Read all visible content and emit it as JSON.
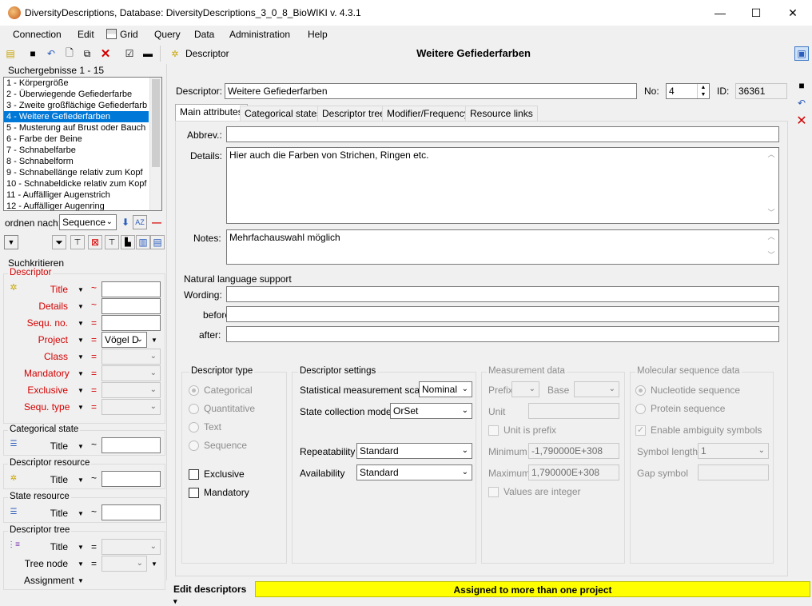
{
  "window": {
    "title": "DiversityDescriptions,  Database: DiversityDescriptions_3_0_8_BioWIKI    v. 4.3.1",
    "min": "—",
    "max": "☐",
    "close": "✕"
  },
  "menu": [
    "Connection",
    "Edit",
    "Grid",
    "Query",
    "Data",
    "Administration",
    "Help"
  ],
  "toolbar": {
    "descriptor_label": "Descriptor",
    "header_title": "Weitere Gefiederfarben"
  },
  "left": {
    "results_label": "Suchergebnisse   1 - 15",
    "results": [
      "1 - Körpergröße",
      "2 - Überwiegende Gefiederfarbe",
      "3 - Zweite großflächige Gefiederfarb",
      "4 - Weitere Gefiederfarben",
      "5 - Musterung auf Brust oder Bauch",
      "6 - Farbe der Beine",
      "7 - Schnabelfarbe",
      "8 - Schnabelform",
      "9 - Schnabellänge relativ zum Kopf",
      "10 - Schnabeldicke relativ zum Kopf",
      "11 - Auffälliger Augenstrich",
      "12 - Auffälliger Augenring"
    ],
    "sort_label": "ordnen nach:",
    "sort_value": "Sequence",
    "criteria_title": "Suchkritieren",
    "descriptor_group": "Descriptor",
    "descriptor_rows": [
      {
        "label": "Title",
        "op": "~",
        "value": ""
      },
      {
        "label": "Details",
        "op": "~",
        "value": ""
      },
      {
        "label": "Sequ. no.",
        "op": "=",
        "value": ""
      },
      {
        "label": "Project",
        "op": "=",
        "value": "Vögel D"
      },
      {
        "label": "Class",
        "op": "=",
        "value": ""
      },
      {
        "label": "Mandatory",
        "op": "=",
        "value": ""
      },
      {
        "label": "Exclusive",
        "op": "=",
        "value": ""
      },
      {
        "label": "Sequ. type",
        "op": "=",
        "value": ""
      }
    ],
    "cat_state_group": "Categorical state",
    "cat_state_title": "Title",
    "cat_state_op": "~",
    "desc_res_group": "Descriptor resource",
    "desc_res_title": "Title",
    "desc_res_op": "~",
    "state_res_group": "State resource",
    "state_res_title": "Title",
    "state_res_op": "~",
    "tree_group": "Descriptor tree",
    "tree_title": "Title",
    "tree_title_op": "=",
    "tree_node": "Tree node",
    "tree_node_op": "=",
    "assignment": "Assignment"
  },
  "form": {
    "descriptor_label": "Descriptor:",
    "descriptor_value": "Weitere Gefiederfarben",
    "no_label": "No:",
    "no_value": "4",
    "id_label": "ID:",
    "id_value": "36361",
    "tabs": [
      "Main attributes",
      "Categorical states",
      "Descriptor tree",
      "Modifier/Frequency",
      "Resource links"
    ],
    "abbrev_label": "Abbrev.:",
    "abbrev_value": "",
    "details_label": "Details:",
    "details_value": "Hier auch die Farben von Strichen, Ringen etc.",
    "notes_label": "Notes:",
    "notes_value": "Mehrfachauswahl möglich",
    "nls_title": "Natural language support",
    "wording_label": "Wording:",
    "before_label": "before:",
    "after_label": "after:",
    "dtype": {
      "title": "Descriptor type",
      "options": [
        "Categorical",
        "Quantitative",
        "Text",
        "Sequence"
      ],
      "exclusive": "Exclusive",
      "mandatory": "Mandatory"
    },
    "dsettings": {
      "title": "Descriptor settings",
      "scale_label": "Statistical measurement scale",
      "scale_value": "Nominal",
      "collection_label": "State collection model",
      "collection_value": "OrSet",
      "repeat_label": "Repeatability",
      "repeat_value": "Standard",
      "avail_label": "Availability",
      "avail_value": "Standard"
    },
    "measure": {
      "title": "Measurement data",
      "prefix": "Prefix",
      "base": "Base",
      "unit": "Unit",
      "unit_is_prefix": "Unit is prefix",
      "minimum": "Minimum",
      "minimum_value": "-1,790000E+308",
      "maximum": "Maximum",
      "maximum_value": "1,790000E+308",
      "values_integer": "Values are integer"
    },
    "molecular": {
      "title": "Molecular sequence data",
      "nucleotide": "Nucleotide sequence",
      "protein": "Protein sequence",
      "ambiguity": "Enable ambiguity symbols",
      "symbol_length": "Symbol length",
      "symbol_length_value": "1",
      "gap": "Gap symbol"
    }
  },
  "status": {
    "left": "Edit descriptors",
    "right": "Assigned to more than one project"
  }
}
